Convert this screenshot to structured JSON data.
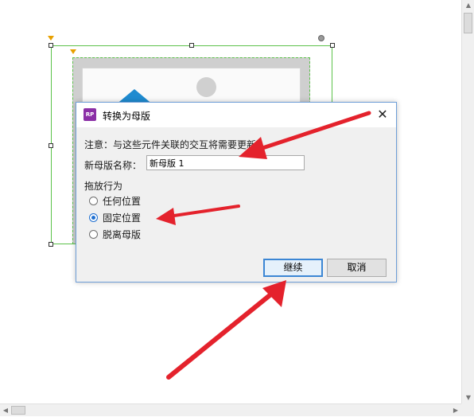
{
  "dialog": {
    "title": "转换为母版",
    "app_icon_text": "RP",
    "notice": "注意：与这些元件关联的交互将需要更新。",
    "name_label": "新母版名称：",
    "name_value": "新母版 1",
    "drag_group_label": "拖放行为",
    "options": [
      {
        "label": "任何位置",
        "selected": false
      },
      {
        "label": "固定位置",
        "selected": true
      },
      {
        "label": "脱离母版",
        "selected": false
      }
    ],
    "continue_label": "继续",
    "cancel_label": "取消"
  },
  "colors": {
    "arrow": "#e4222c",
    "selection": "#5cc24a",
    "dialog_border": "#6f9fd8",
    "radio_selected": "#1f6fd0"
  }
}
